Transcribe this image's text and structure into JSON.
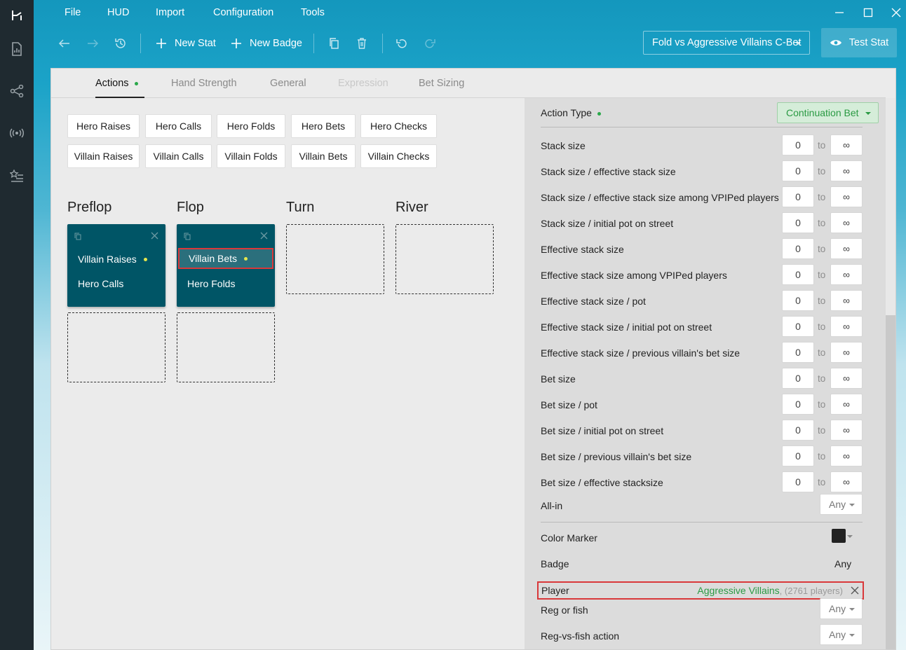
{
  "menu": [
    "File",
    "HUD",
    "Import",
    "Configuration",
    "Tools"
  ],
  "toolbar": {
    "new_stat": "New Stat",
    "new_badge": "New Badge",
    "preset": "Fold vs Aggressive Villains C-Bet",
    "test_stat": "Test Stat"
  },
  "tabs": [
    "Actions",
    "Hand Strength",
    "General",
    "Expression",
    "Bet Sizing"
  ],
  "hero_actions": [
    "Hero Raises",
    "Hero Calls",
    "Hero Folds",
    "Hero Bets",
    "Hero Checks"
  ],
  "villain_actions": [
    "Villain Raises",
    "Villain Calls",
    "Villain Folds",
    "Villain Bets",
    "Villain Checks"
  ],
  "streets": [
    "Preflop",
    "Flop",
    "Turn",
    "River"
  ],
  "preflop_card": [
    "Villain Raises",
    "Hero Calls"
  ],
  "flop_card": [
    "Villain Bets",
    "Hero Folds"
  ],
  "filters": {
    "action_type_label": "Action Type",
    "action_type_value": "Continuation Bet",
    "to_label": "to",
    "min_value": "0",
    "max_value": "∞",
    "ranges": [
      "Stack size",
      "Stack size / effective stack size",
      "Stack size / effective stack size among VPIPed players",
      "Stack size / initial pot on street",
      "Effective stack size",
      "Effective stack size among VPIPed players",
      "Effective stack size / pot",
      "Effective stack size / initial pot on street",
      "Effective stack size / previous villain's bet size",
      "Bet size",
      "Bet size / pot",
      "Bet size / initial pot on street",
      "Bet size / previous villain's bet size",
      "Bet size / effective stacksize"
    ],
    "all_in_label": "All-in",
    "any": "Any",
    "color_marker_label": "Color Marker",
    "color_marker_value": "#222222",
    "badge_label": "Badge",
    "player_label": "Player",
    "player_value": "Aggressive Villains",
    "player_count": ", (2761 players)",
    "reg_or_fish_label": "Reg or fish",
    "reg_vs_fish_label": "Reg-vs-fish action"
  }
}
